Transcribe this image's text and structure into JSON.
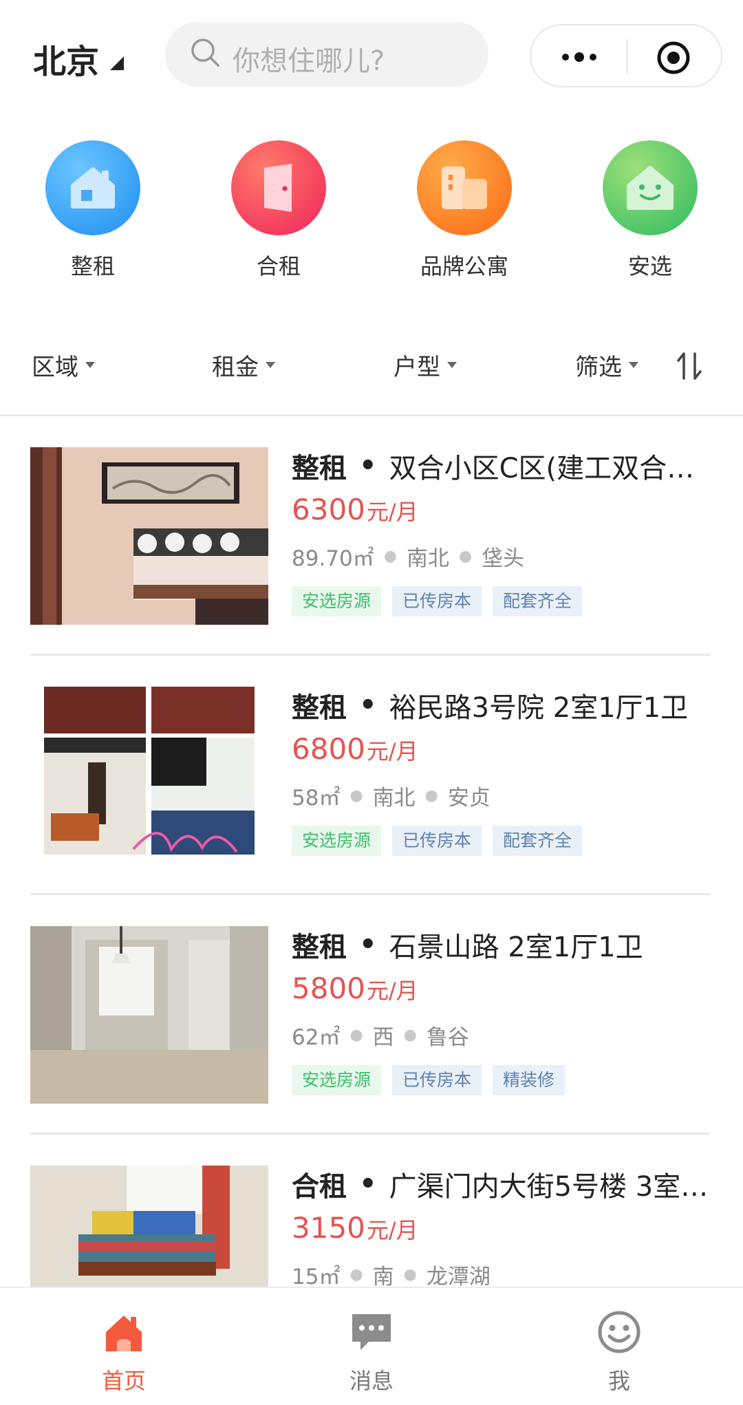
{
  "header": {
    "city": "北京",
    "search_placeholder": "你想住哪儿?"
  },
  "categories": [
    {
      "label": "整租",
      "icon": "house-icon",
      "color": "#2f9cf0"
    },
    {
      "label": "合租",
      "icon": "door-icon",
      "color": "#f2405e"
    },
    {
      "label": "品牌公寓",
      "icon": "apartment-icon",
      "color": "#fb7a1e"
    },
    {
      "label": "安选",
      "icon": "smile-house-icon",
      "color": "#3fbf62"
    }
  ],
  "filters": [
    {
      "label": "区域"
    },
    {
      "label": "租金"
    },
    {
      "label": "户型"
    },
    {
      "label": "筛选"
    }
  ],
  "listings": [
    {
      "type": "整租",
      "name": "双合小区C区(建工双合家园)…",
      "price": "6300",
      "unit": "元/月",
      "area": "89.70㎡",
      "orientation": "南北",
      "location": "垡头",
      "tags": [
        "安选房源",
        "已传房本",
        "配套齐全"
      ]
    },
    {
      "type": "整租",
      "name": "裕民路3号院 2室1厅1卫",
      "price": "6800",
      "unit": "元/月",
      "area": "58㎡",
      "orientation": "南北",
      "location": "安贞",
      "tags": [
        "安选房源",
        "已传房本",
        "配套齐全"
      ]
    },
    {
      "type": "整租",
      "name": "石景山路 2室1厅1卫",
      "price": "5800",
      "unit": "元/月",
      "area": "62㎡",
      "orientation": "西",
      "location": "鲁谷",
      "tags": [
        "安选房源",
        "已传房本",
        "精装修"
      ]
    },
    {
      "type": "合租",
      "name": "广渠门内大街5号楼 3室…",
      "price": "3150",
      "unit": "元/月",
      "area": "15㎡",
      "orientation": "南",
      "location": "龙潭湖"
    }
  ],
  "tabbar": [
    {
      "label": "首页",
      "icon": "home-icon",
      "active": true
    },
    {
      "label": "消息",
      "icon": "message-icon",
      "active": false
    },
    {
      "label": "我",
      "icon": "smiley-icon",
      "active": false
    }
  ],
  "colors": {
    "accent": "#f25a3e",
    "price": "#e8524f",
    "tag_green": "#3cbf6b",
    "tag_blue": "#5f82ad"
  }
}
